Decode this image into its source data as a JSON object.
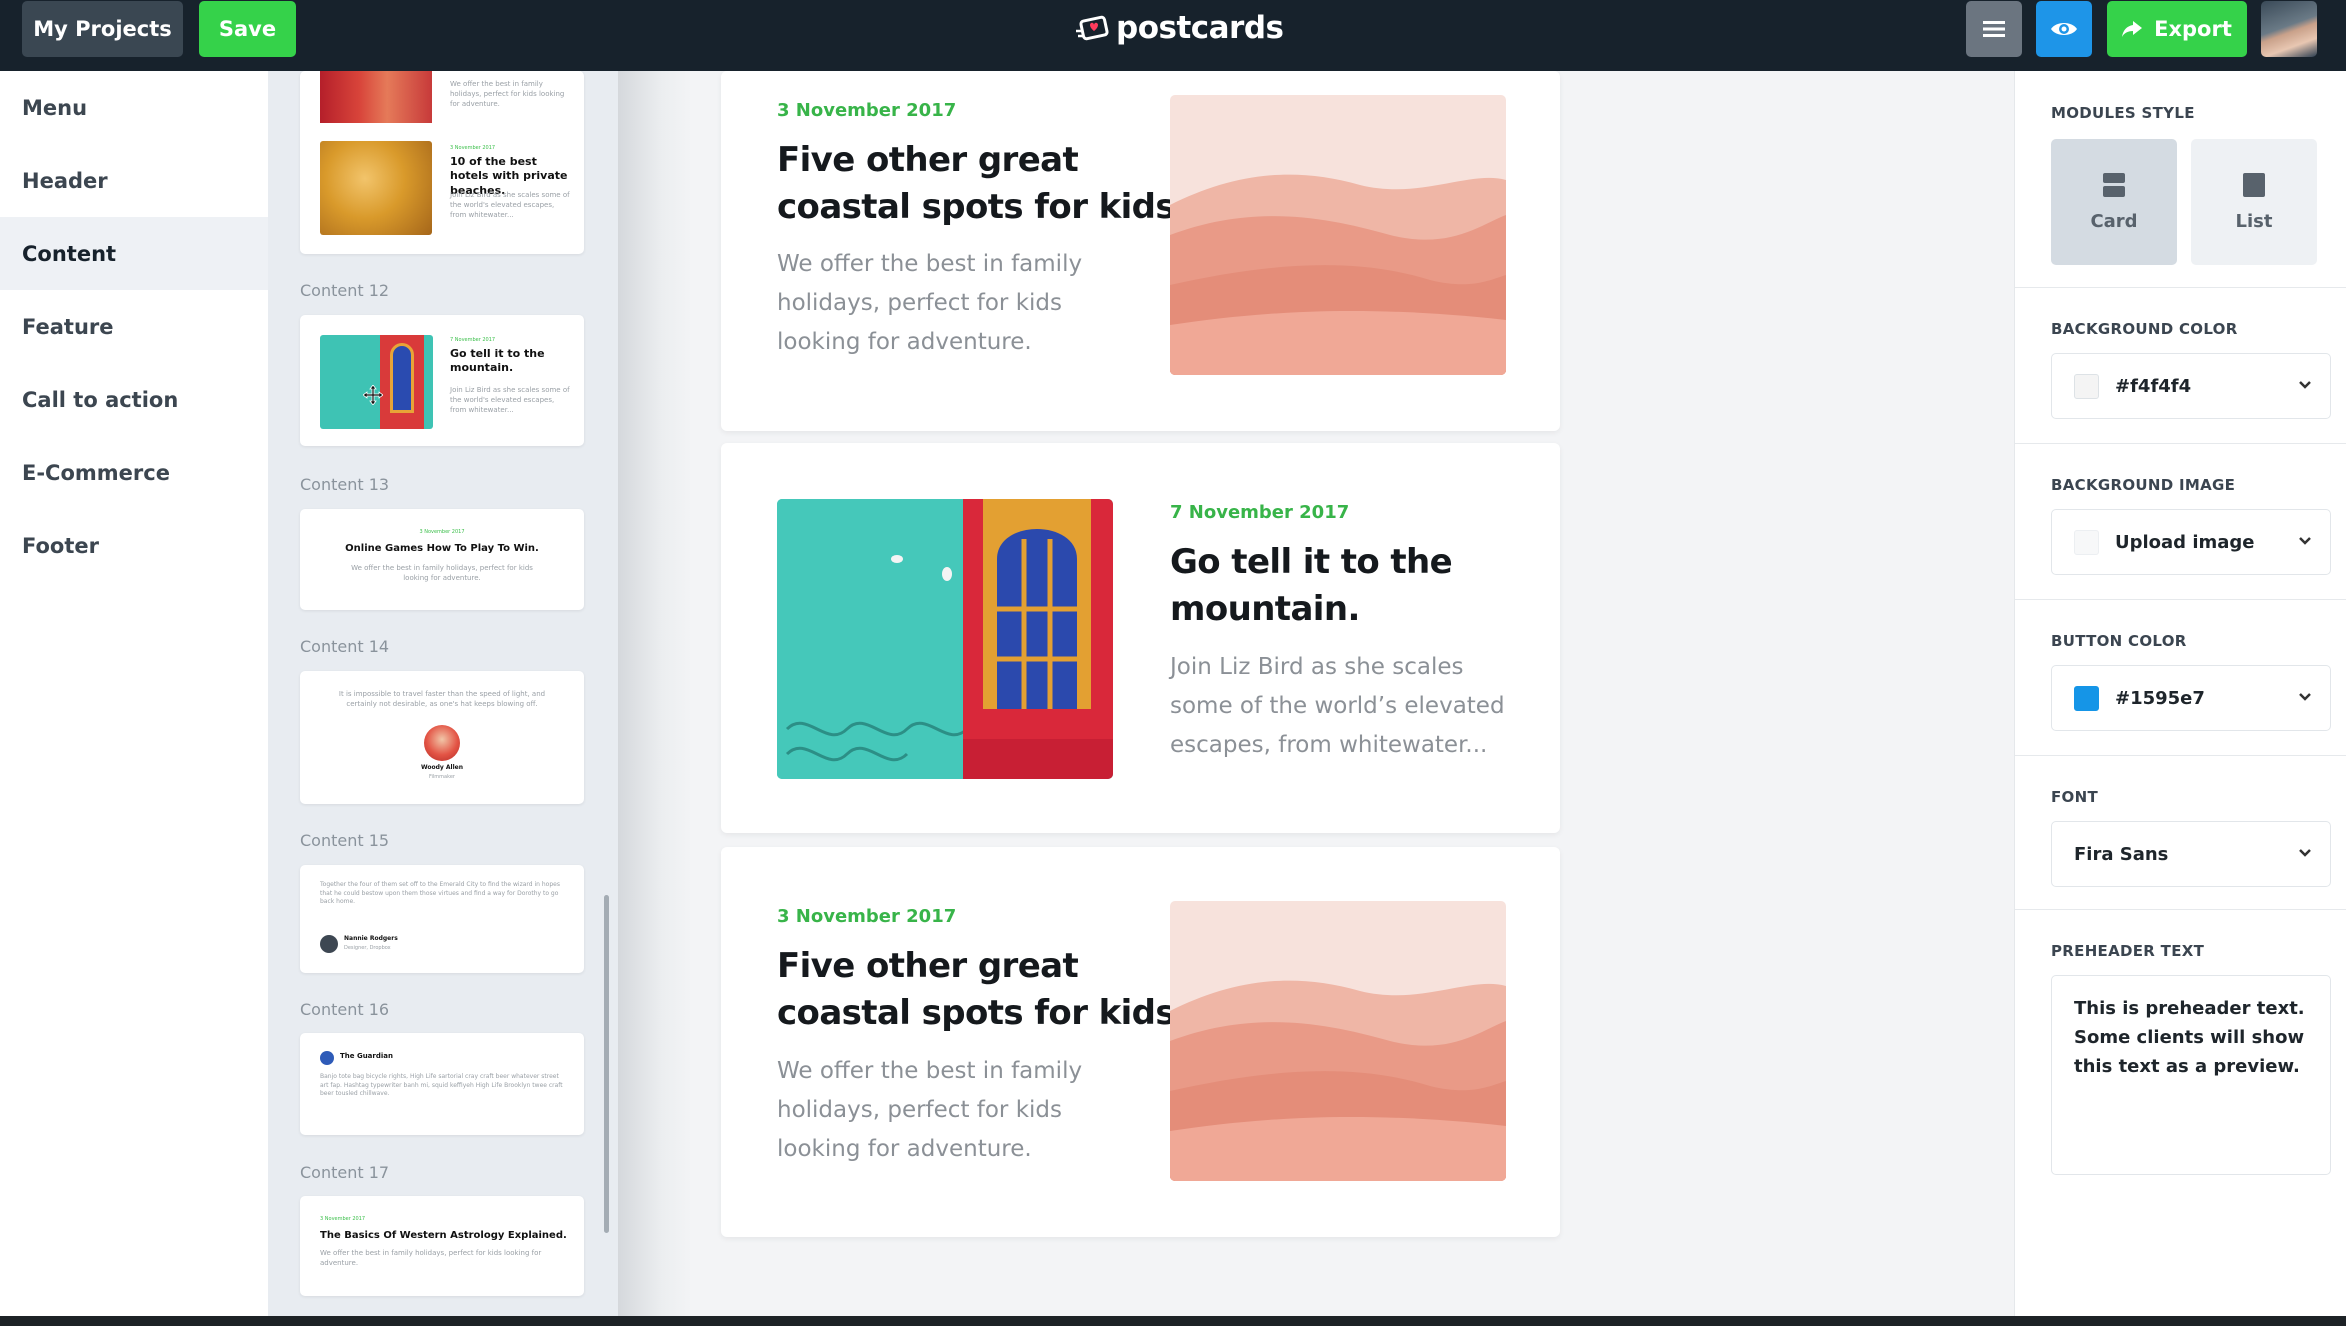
{
  "topbar": {
    "my_projects_label": "My Projects",
    "save_label": "Save",
    "logo_text": "postcards",
    "export_label": "Export",
    "icons": [
      "hamburger-icon",
      "eye-icon",
      "share-arrow-icon"
    ]
  },
  "left_nav": {
    "items": [
      {
        "label": "Menu"
      },
      {
        "label": "Header"
      },
      {
        "label": "Content",
        "active": true
      },
      {
        "label": "Feature"
      },
      {
        "label": "Call to action"
      },
      {
        "label": "E-Commerce"
      },
      {
        "label": "Footer"
      }
    ]
  },
  "thumbs": {
    "top_card_text": "We offer the best in family holidays, perfect for kids looking for adventure.",
    "card_a": {
      "date": "3 November 2017",
      "title": "10 of the best hotels with private beaches.",
      "text": "Join Liz Bird as she scales some of the world's elevated escapes, from whitewater..."
    },
    "labels": [
      "Content 12",
      "Content 13",
      "Content 14",
      "Content 15",
      "Content 16",
      "Content 17"
    ],
    "c12": {
      "date": "7 November 2017",
      "title": "Go tell it to the mountain.",
      "text": "Join Liz Bird as she scales some of the world's elevated escapes, from whitewater..."
    },
    "c13": {
      "date": "3 November 2017",
      "title": "Online Games How To Play To Win.",
      "text": "We offer the best in family holidays, perfect for kids looking for adventure."
    },
    "c14": {
      "quote": "It is impossible to travel faster than the speed of light, and certainly not desirable, as one's hat keeps blowing off.",
      "name": "Woody Allen",
      "role": "Filmmaker"
    },
    "c15": {
      "text": "Together the four of them set off to the Emerald City to find the wizard in hopes that he could bestow upon them those virtues and find a way for Dorothy to go back home.",
      "name": "Nannie Rodgers",
      "role": "Designer, Dropbox"
    },
    "c16": {
      "source": "The Guardian",
      "text": "Banjo tote bag bicycle rights, High Life sartorial cray craft beer whatever street art fap. Hashtag typewriter banh mi, squid keffiyeh High Life Brooklyn twee craft beer tousled chillwave."
    },
    "c17": {
      "date": "3 November 2017",
      "title": "The Basics Of Western Astrology Explained.",
      "text": "We offer the best in family holidays, perfect for kids looking for adventure."
    }
  },
  "canvas": {
    "cards": [
      {
        "date": "3 November 2017",
        "title_line1": "Five other great",
        "title_line2": "coastal spots for kids.",
        "text_line1": "We offer the best in family",
        "text_line2": "holidays, perfect for kids",
        "text_line3": "looking for adventure.",
        "image": "desert-dunes"
      },
      {
        "date": "7 November 2017",
        "title_line1": "Go tell it to the",
        "title_line2": "mountain.",
        "text_line1": "Join Liz Bird as she scales",
        "text_line2": "some of the world’s elevated",
        "text_line3": "escapes, from whitewater...",
        "image": "turquoise-wall-window"
      },
      {
        "date": "3 November 2017",
        "title_line1": "Five other great",
        "title_line2": "coastal spots for kids.",
        "text_line1": "We offer the best in family",
        "text_line2": "holidays, perfect for kids",
        "text_line3": "looking for adventure.",
        "image": "desert-dunes"
      }
    ]
  },
  "right_panel": {
    "modules_style_title": "MODULES STYLE",
    "card_label": "Card",
    "list_label": "List",
    "bg_color_title": "BACKGROUND COLOR",
    "bg_color_value": "#f4f4f4",
    "bg_image_title": "BACKGROUND IMAGE",
    "bg_image_value": "Upload image",
    "button_color_title": "BUTTON COLOR",
    "button_color_value": "#1595e7",
    "font_title": "FONT",
    "font_value": "Fira Sans",
    "preheader_title": "PREHEADER TEXT",
    "preheader_value": "This is preheader text. Some clients will show this text as a preview."
  },
  "colors": {
    "topbar_bg": "#17222c",
    "save_green": "#35d24a",
    "preview_blue": "#1e95e8",
    "date_green": "#38b449",
    "bg_swatch": "#f4f4f4",
    "button_swatch": "#1595e7"
  }
}
